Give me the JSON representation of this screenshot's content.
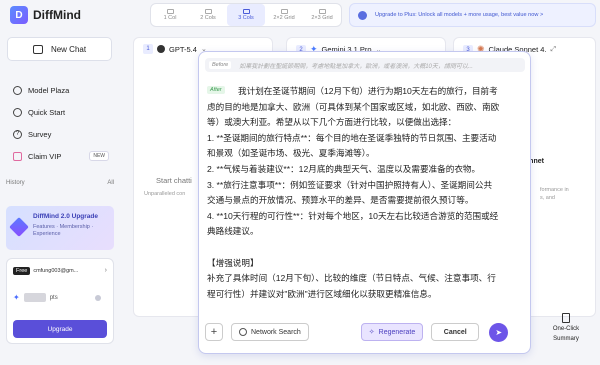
{
  "app": {
    "name": "DiffMind"
  },
  "sidebar": {
    "new_chat": "New Chat",
    "items": [
      {
        "label": "Model Plaza",
        "icon": "cube-icon"
      },
      {
        "label": "Quick Start",
        "icon": "bolt-icon"
      },
      {
        "label": "Survey",
        "icon": "question-icon"
      },
      {
        "label": "Claim VIP",
        "icon": "gift-icon",
        "badge": "NEW"
      }
    ],
    "history_label": "History",
    "history_filter": "All",
    "upgrade": {
      "title": "DiffMind 2.0 Upgrade",
      "subtitle": "Features · Membership · Experience"
    },
    "account": {
      "plan": "Free",
      "email": "cmfung003@gm...",
      "points_suffix": "pts",
      "upgrade_button": "Upgrade"
    }
  },
  "layout_tabs": [
    {
      "label": "1 Col",
      "active": false
    },
    {
      "label": "2 Cols",
      "active": false
    },
    {
      "label": "3 Cols",
      "active": true
    },
    {
      "label": "2×2 Grid",
      "active": false
    },
    {
      "label": "2×3 Grid",
      "active": false
    }
  ],
  "promo": "Upgrade to Plus: Unlock all models + more usage, best value now >",
  "columns": [
    {
      "num": "1",
      "model": "GPT-5.4",
      "dropdown": "⌄"
    },
    {
      "num": "2",
      "model": "Gemini 3.1 Pro",
      "dropdown": "⌄"
    },
    {
      "num": "3",
      "model": "Claude Sonnet 4."
    }
  ],
  "column_bodies": {
    "start_chat": "Start chatti",
    "unparalleled": "Unparalleled con",
    "claude_title": "laude Sonnet",
    "claude_desc_1": "formance in",
    "claude_desc_2": "s, and"
  },
  "editor": {
    "before_tag": "Before",
    "before_text": "如果我計劃在聖誕節期間，考慮地點是加拿大，歐洲，或者澳洲，大概10天，請問可以...",
    "after_tag": "After",
    "after_lines": [
      "我计划在圣诞节期间（12月下旬）进行为期10天左右的旅行，目前考",
      "虑的目的地是加拿大、欧洲（可具体到某个国家或区域，如北欧、西欧、南欧",
      "等）或澳大利亚。希望从以下几个方面进行比较，以便做出选择：",
      "1. **圣诞期间的旅行特点**：每个目的地在圣诞季独特的节日氛围、主要活动",
      "和景观（如圣诞市场、极光、夏季海滩等）。",
      "2. **气候与着装建议**：12月底的典型天气、温度以及需要准备的衣物。",
      "3. **旅行注意事项**：例如签证要求（针对中国护照持有人）、圣诞期间公共",
      "交通与景点的开放情况、预算水平的差异、是否需要提前很久预订等。",
      "4. **10天行程的可行性**：针对每个地区，10天左右比较适合游览的范围或经",
      "典路线建议。",
      "",
      "【增强说明】",
      "补充了具体时间（12月下旬）、比较的维度（节日特点、气候、注意事项、行",
      "程可行性）并建议对\"欧洲\"进行区域细化以获取更精准信息。"
    ],
    "plus": "+",
    "network_search": "Network Search",
    "regenerate": "Regenerate",
    "cancel": "Cancel"
  },
  "summary": {
    "line1": "One-Click",
    "line2": "Summary"
  },
  "colors": {
    "accent": "#5a4fd9",
    "promo": "#3f56d0",
    "after_green": "#3b9a50"
  }
}
